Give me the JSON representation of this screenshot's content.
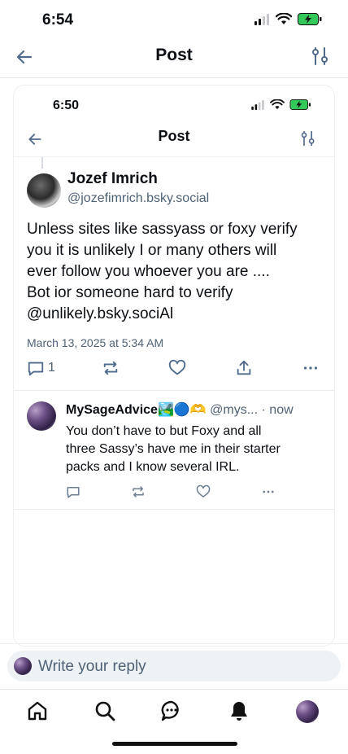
{
  "status_bar": {
    "time": "6:54"
  },
  "header": {
    "title": "Post"
  },
  "embedded": {
    "status_time": "6:50",
    "header_title": "Post",
    "post": {
      "author_name": "Jozef Imrich",
      "author_handle": "@jozefimrich.bsky.social",
      "text": "Unless sites like sassyass or foxy verify\nyou it is unlikely I or many others will\never follow you  whoever you are ....\nBot ior someone hard to verify\n@unlikely.bsky.sociAl",
      "date": "March 13, 2025 at 5:34 AM",
      "reply_count": "1"
    },
    "reply": {
      "author_name": "MySageAdvice",
      "emoji": "🏞️🔵🫶",
      "handle": "@mys...",
      "time": "· now",
      "text": "You don’t have to but Foxy and all\nthree Sassy’s have me in their starter\npacks and I know several IRL."
    }
  },
  "composer": {
    "placeholder": "Write your reply"
  },
  "colors": {
    "accent": "#1185fe",
    "muted": "#4f6175",
    "battery": "#34c759"
  },
  "icons": [
    "back-arrow-icon",
    "tune-icon",
    "reply-icon",
    "repost-icon",
    "like-icon",
    "share-icon",
    "more-icon",
    "home-icon",
    "search-icon",
    "chat-icon",
    "bell-icon"
  ]
}
